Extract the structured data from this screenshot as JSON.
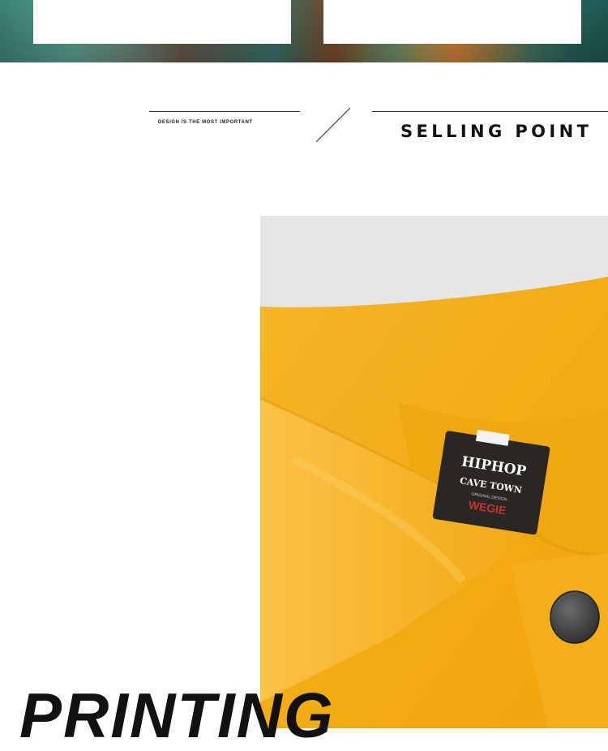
{
  "header": {
    "tagline": "DESIGN IS THE MOST IMPORTANT",
    "title": "SELLING POINT"
  },
  "product_photo": {
    "label_line1": "HIPHOP",
    "label_line2": "CAVE TOWN",
    "label_line3": "ORIGINAL DESIGN",
    "label_line4": "WEGIE",
    "fabric_color": "#F5B21F",
    "background_color": "#E4E4E4",
    "button_color": "#3E3E3E",
    "tag_color": "#2A2624"
  },
  "feature": {
    "word": "PRINTING"
  }
}
